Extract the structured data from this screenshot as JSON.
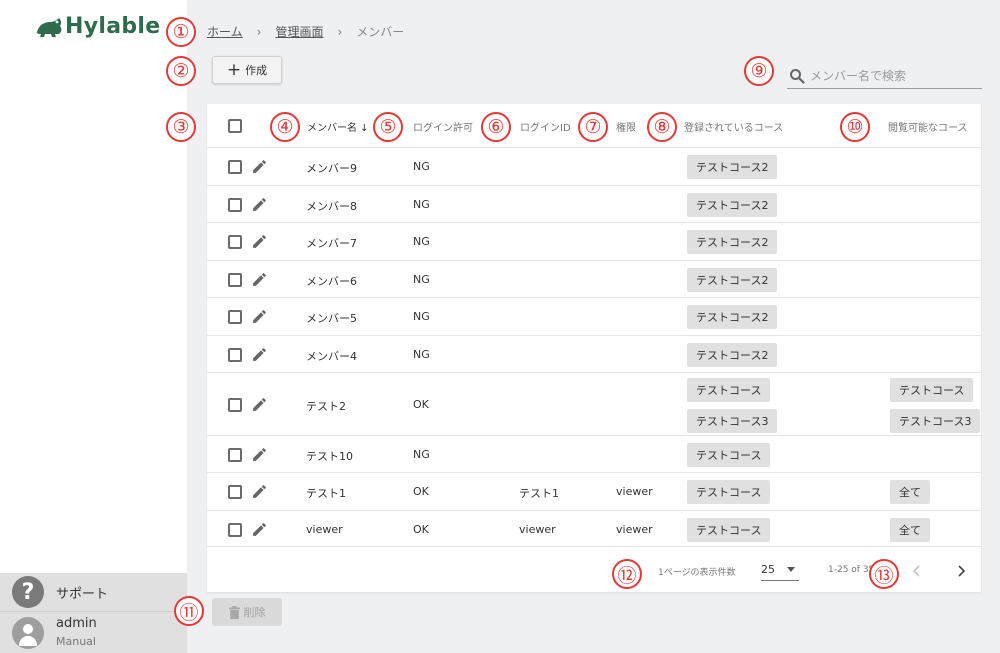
{
  "app": {
    "brand": "Hylable"
  },
  "breadcrumb": {
    "home": "ホーム",
    "admin": "管理画面",
    "current": "メンバー"
  },
  "toolbar": {
    "create_label": "作成",
    "delete_label": "削除"
  },
  "search": {
    "placeholder": "メンバー名で検索"
  },
  "table": {
    "headers": {
      "name": "メンバー名",
      "login_permission": "ログイン許可",
      "login_id": "ログインID",
      "role": "権限",
      "registered_courses": "登録されているコース",
      "viewable_courses": "閲覧可能なコース"
    },
    "rows": [
      {
        "name": "メンバー9",
        "login": "NG",
        "login_id": "",
        "role": "",
        "registered": [
          "テストコース2"
        ],
        "viewable": []
      },
      {
        "name": "メンバー8",
        "login": "NG",
        "login_id": "",
        "role": "",
        "registered": [
          "テストコース2"
        ],
        "viewable": []
      },
      {
        "name": "メンバー7",
        "login": "NG",
        "login_id": "",
        "role": "",
        "registered": [
          "テストコース2"
        ],
        "viewable": []
      },
      {
        "name": "メンバー6",
        "login": "NG",
        "login_id": "",
        "role": "",
        "registered": [
          "テストコース2"
        ],
        "viewable": []
      },
      {
        "name": "メンバー5",
        "login": "NG",
        "login_id": "",
        "role": "",
        "registered": [
          "テストコース2"
        ],
        "viewable": []
      },
      {
        "name": "メンバー4",
        "login": "NG",
        "login_id": "",
        "role": "",
        "registered": [
          "テストコース2"
        ],
        "viewable": []
      },
      {
        "name": "テスト2",
        "login": "OK",
        "login_id": "",
        "role": "",
        "registered": [
          "テストコース",
          "テストコース3"
        ],
        "viewable": [
          "テストコース",
          "テストコース3"
        ]
      },
      {
        "name": "テスト10",
        "login": "NG",
        "login_id": "",
        "role": "",
        "registered": [
          "テストコース"
        ],
        "viewable": []
      },
      {
        "name": "テスト1",
        "login": "OK",
        "login_id": "テスト1",
        "role": "viewer",
        "registered": [
          "テストコース"
        ],
        "viewable": [
          "全て"
        ]
      },
      {
        "name": "viewer",
        "login": "OK",
        "login_id": "viewer",
        "role": "viewer",
        "registered": [
          "テストコース"
        ],
        "viewable": [
          "全て"
        ]
      }
    ]
  },
  "pagination": {
    "rows_per_page_label": "1ページの表示件数",
    "rows_per_page": "25",
    "range": "1-25 of 35"
  },
  "sidebar": {
    "support_label": "サポート",
    "user_name": "admin",
    "user_role": "Manual"
  },
  "markers": [
    "①",
    "②",
    "③",
    "④",
    "⑤",
    "⑥",
    "⑦",
    "⑧",
    "⑨",
    "⑩",
    "⑪",
    "⑫",
    "⑬"
  ],
  "colors": {
    "brand": "#2f6b4d",
    "marker": "#e53935",
    "background": "#eef0f2"
  }
}
